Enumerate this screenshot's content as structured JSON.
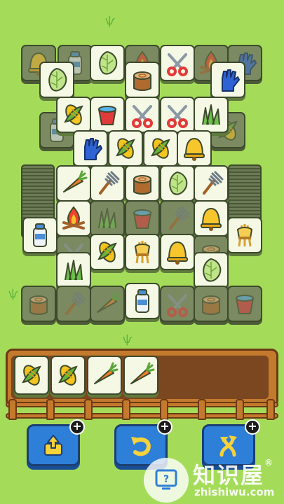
{
  "game": {
    "board": {
      "tile_types": [
        "corn",
        "carrot",
        "cabbage",
        "pitchfork",
        "stump",
        "campfire",
        "glove",
        "shears",
        "bell",
        "wheat",
        "milk",
        "grass",
        "bucket"
      ]
    },
    "tray": {
      "slots": [
        "corn",
        "corn",
        "carrot",
        "carrot"
      ],
      "capacity": 7
    },
    "powerups": [
      {
        "name": "undo-last",
        "icon": "tile-return-icon",
        "badge": "+"
      },
      {
        "name": "undo",
        "icon": "undo-arrow-icon",
        "badge": "+"
      },
      {
        "name": "shuffle",
        "icon": "shuffle-arrows-icon",
        "badge": "+"
      }
    ],
    "colors": {
      "background": "#a4dc5a",
      "tile_face": "#f4f8e4",
      "tile_dim": "#7b8a60",
      "tray_wood": "#c47a2c",
      "button_blue": "#2e7fd8"
    }
  },
  "watermark": {
    "name": "知识屋",
    "reg_mark": "®",
    "url": "zhishiwu.com"
  }
}
